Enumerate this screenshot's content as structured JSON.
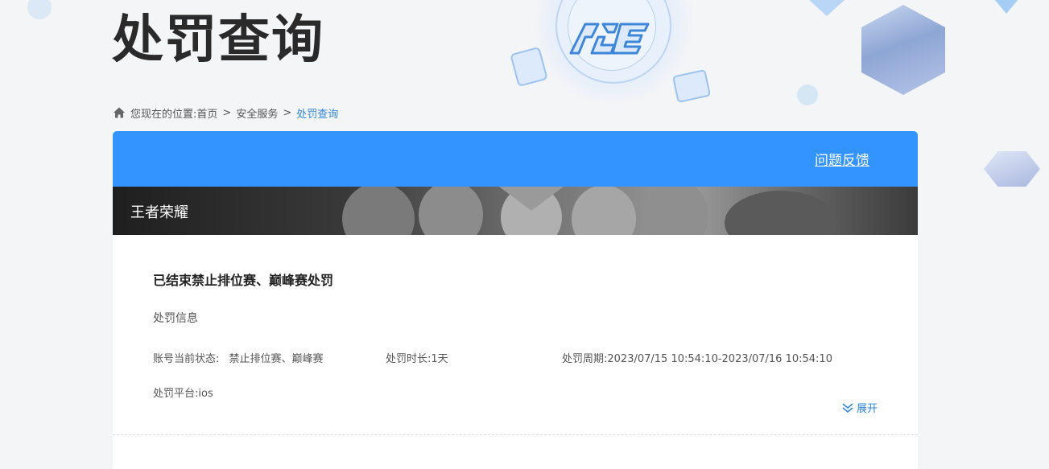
{
  "page": {
    "title": "处罚查询"
  },
  "breadcrumb": {
    "prefix": "您现在的位置:",
    "items": [
      "首页",
      "安全服务"
    ],
    "separator": ">",
    "current": "处罚查询",
    "icon": "home-icon"
  },
  "header": {
    "feedback_label": "问题反馈",
    "accent_color": "#3494ff"
  },
  "game": {
    "name": "王者荣耀"
  },
  "penalty": {
    "title": "已结束禁止排位赛、巅峰赛处罚",
    "section_label": "处罚信息",
    "status_label": "账号当前状态:",
    "status_value": "禁止排位赛、巅峰赛",
    "duration_label": "处罚时长:",
    "duration_value": "1天",
    "period_label": "处罚周期:",
    "period_value": "2023/07/15 10:54:10-2023/07/16 10:54:10",
    "platform_label": "处罚平台:",
    "platform_value": "ios",
    "expand_label": "展开",
    "expand_icon": "double-chevron-down-icon"
  },
  "logo": {
    "text": "ACE"
  }
}
